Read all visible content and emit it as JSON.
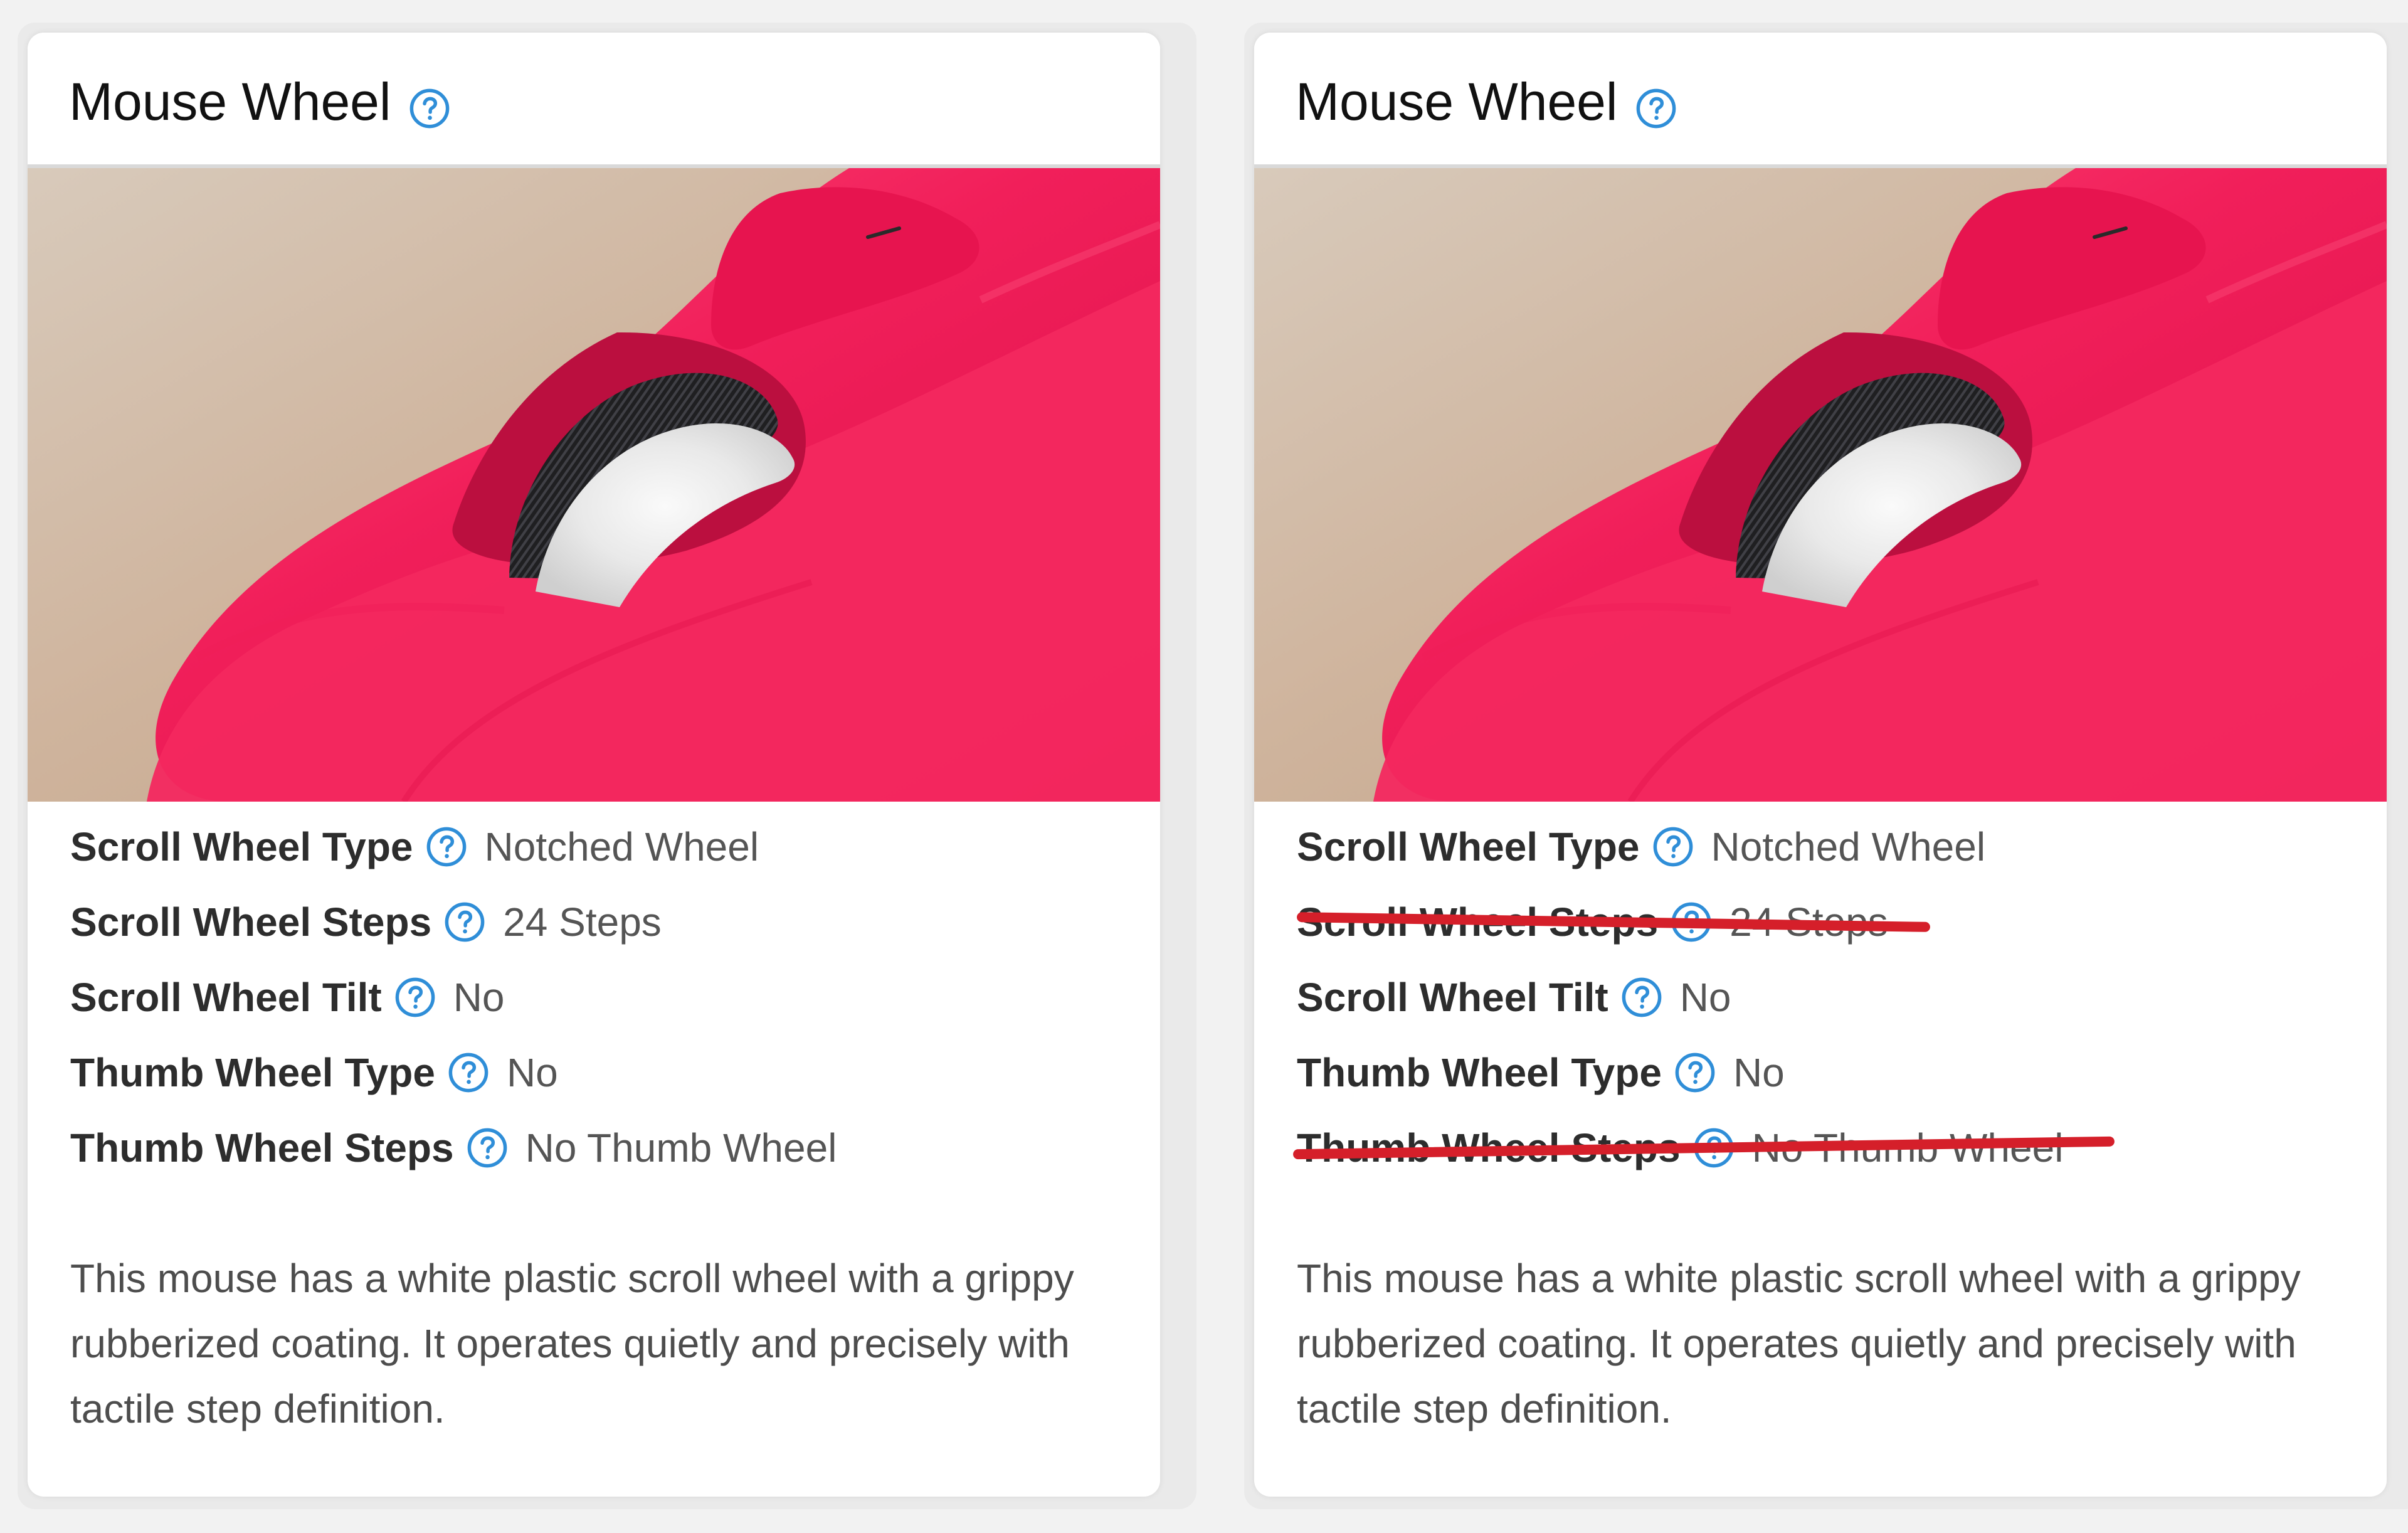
{
  "colors": {
    "accent_blue": "#2f8ed8",
    "strike_red": "#d51f2a",
    "mouse_pink": "#f11f5a"
  },
  "left": {
    "card": {
      "title": "Mouse Wheel",
      "help_icon": "help-icon",
      "image_alt": "Close-up of pink mouse scroll wheel",
      "specs": [
        {
          "label": "Scroll Wheel Type",
          "value": "Notched Wheel"
        },
        {
          "label": "Scroll Wheel Steps",
          "value": "24 Steps"
        },
        {
          "label": "Scroll Wheel Tilt",
          "value": "No"
        },
        {
          "label": "Thumb Wheel Type",
          "value": "No"
        },
        {
          "label": "Thumb Wheel Steps",
          "value": "No Thumb Wheel"
        }
      ],
      "description": "This mouse has a white plastic scroll wheel with a grippy rubberized coating. It operates quietly and precisely with tactile step definition."
    }
  },
  "right": {
    "card": {
      "title": "Mouse Wheel",
      "help_icon": "help-icon",
      "image_alt": "Close-up of pink mouse scroll wheel",
      "specs": [
        {
          "label": "Scroll Wheel Type",
          "value": "Notched Wheel"
        },
        {
          "label": "Scroll Wheel Steps",
          "value": "24 Steps",
          "struck": true
        },
        {
          "label": "Scroll Wheel Tilt",
          "value": "No"
        },
        {
          "label": "Thumb Wheel Type",
          "value": "No"
        },
        {
          "label": "Thumb Wheel Steps",
          "value": "No Thumb Wheel",
          "struck": true
        }
      ],
      "description": "This mouse has a white plastic scroll wheel with a grippy rubberized coating. It operates quietly and precisely with tactile step definition."
    }
  }
}
